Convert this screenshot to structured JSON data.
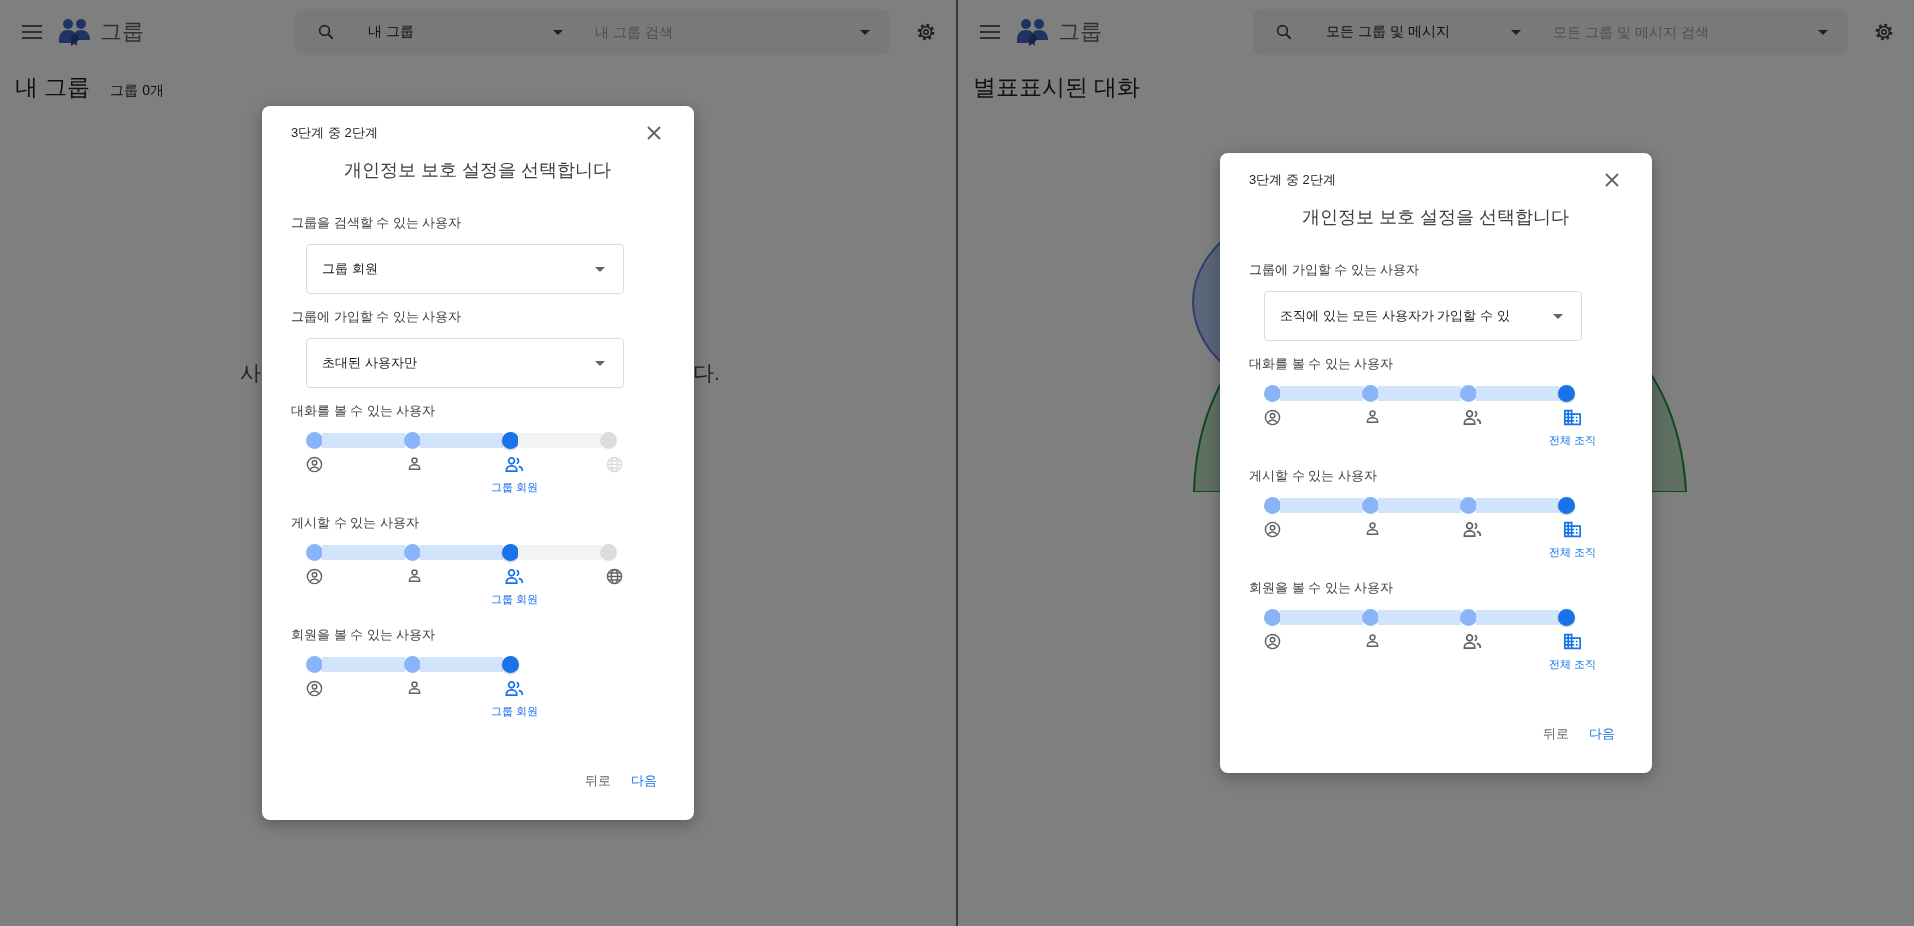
{
  "panes": [
    {
      "app_title": "그룹",
      "search": {
        "scope": "내 그룹",
        "placeholder": "내 그룹 검색"
      },
      "page_title": "내 그룹",
      "group_count": "그룹 0개",
      "empty_message": {
        "start": "사",
        "end": "다."
      },
      "dialog": {
        "step": "3단계 중 2단계",
        "title": "개인정보 보호 설정을 선택합니다",
        "dropdowns": [
          {
            "label": "그룹을 검색할 수 있는 사용자",
            "value": "그룹 회원"
          },
          {
            "label": "그룹에 가입할 수 있는 사용자",
            "value": "초대된 사용자만"
          }
        ],
        "sliders": [
          {
            "label": "대화를 볼 수 있는 사용자",
            "selected_label": "그룹 회원",
            "stops": [
              {
                "kind": "owner",
                "selected": false,
                "disabled": false
              },
              {
                "kind": "person",
                "selected": false,
                "disabled": false
              },
              {
                "kind": "group",
                "selected": true,
                "disabled": false
              },
              {
                "kind": "public",
                "selected": false,
                "disabled": true
              }
            ]
          },
          {
            "label": "게시할 수 있는 사용자",
            "selected_label": "그룹 회원",
            "stops": [
              {
                "kind": "owner",
                "selected": false,
                "disabled": false
              },
              {
                "kind": "person",
                "selected": false,
                "disabled": false
              },
              {
                "kind": "group",
                "selected": true,
                "disabled": false
              },
              {
                "kind": "public",
                "selected": false,
                "disabled": false
              }
            ]
          },
          {
            "label": "회원을 볼 수 있는 사용자",
            "selected_label": "그룹 회원",
            "stops": [
              {
                "kind": "owner",
                "selected": false,
                "disabled": false
              },
              {
                "kind": "person",
                "selected": false,
                "disabled": false
              },
              {
                "kind": "group",
                "selected": true,
                "disabled": false
              }
            ]
          }
        ],
        "buttons": [
          {
            "label": "뒤로",
            "kind": "back"
          },
          {
            "label": "다음",
            "kind": "next"
          }
        ]
      }
    },
    {
      "app_title": "그룹",
      "search": {
        "scope": "모든 그룹 및 메시지",
        "placeholder": "모든 그룹 및 메시지 검색"
      },
      "page_title": "별표표시된 대화",
      "illustration": true,
      "dialog": {
        "step": "3단계 중 2단계",
        "title": "개인정보 보호 설정을 선택합니다",
        "dropdowns": [
          {
            "label": "그룹에 가입할 수 있는 사용자",
            "value": "조직에 있는 모든 사용자가 가입할 수 있"
          }
        ],
        "sliders": [
          {
            "label": "대화를 볼 수 있는 사용자",
            "selected_label": "전체 조직",
            "stops": [
              {
                "kind": "owner",
                "selected": false,
                "disabled": false
              },
              {
                "kind": "person",
                "selected": false,
                "disabled": false
              },
              {
                "kind": "group",
                "selected": false,
                "disabled": false
              },
              {
                "kind": "organization",
                "selected": true,
                "disabled": false
              }
            ]
          },
          {
            "label": "게시할 수 있는 사용자",
            "selected_label": "전체 조직",
            "stops": [
              {
                "kind": "owner",
                "selected": false,
                "disabled": false
              },
              {
                "kind": "person",
                "selected": false,
                "disabled": false
              },
              {
                "kind": "group",
                "selected": false,
                "disabled": false
              },
              {
                "kind": "organization",
                "selected": true,
                "disabled": false
              }
            ]
          },
          {
            "label": "회원을 볼 수 있는 사용자",
            "selected_label": "전체 조직",
            "stops": [
              {
                "kind": "owner",
                "selected": false,
                "disabled": false
              },
              {
                "kind": "person",
                "selected": false,
                "disabled": false
              },
              {
                "kind": "group",
                "selected": false,
                "disabled": false
              },
              {
                "kind": "organization",
                "selected": true,
                "disabled": false
              }
            ]
          }
        ],
        "buttons": [
          {
            "label": "뒤로",
            "kind": "back"
          },
          {
            "label": "다음",
            "kind": "next"
          }
        ]
      }
    }
  ]
}
